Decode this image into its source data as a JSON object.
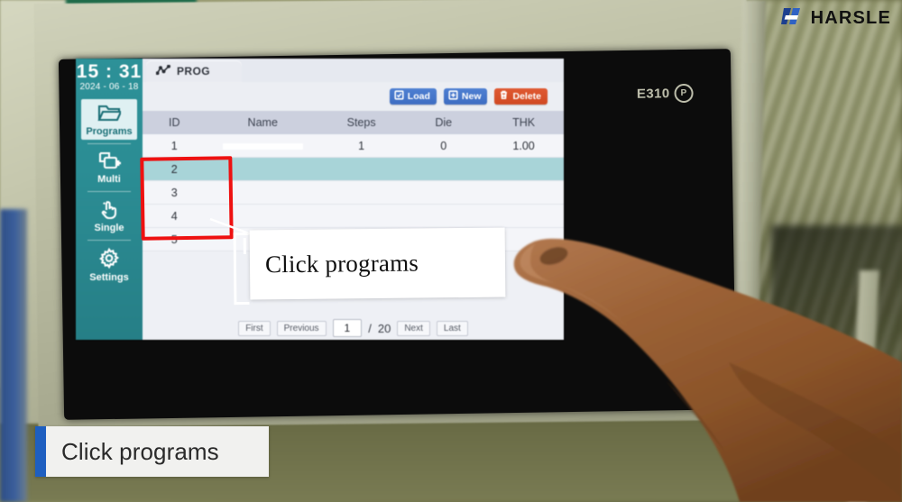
{
  "brand": {
    "name": "HARSLE",
    "logo_icon": "harsle-h-mark",
    "accent": "#1c3f8f"
  },
  "monitor": {
    "model_badge": "E310",
    "model_badge_suffix": "P"
  },
  "hmi": {
    "sidebar": {
      "time": "15 : 31",
      "date": "2024 - 06 - 18",
      "items": [
        {
          "label": "Programs",
          "icon": "folder-open-icon",
          "active": true
        },
        {
          "label": "Multi",
          "icon": "multi-window-plus-icon",
          "active": false
        },
        {
          "label": "Single",
          "icon": "hand-tap-icon",
          "active": false
        },
        {
          "label": "Settings",
          "icon": "gear-icon",
          "active": false
        }
      ],
      "bg_color": "#2d8d93",
      "active_tile_color": "#dff0f2"
    },
    "tab": {
      "label": "PROG",
      "icon": "polyline-graph-icon"
    },
    "toolbar": [
      {
        "label": "Load",
        "icon": "document-check-icon",
        "color": "#4471c6"
      },
      {
        "label": "New",
        "icon": "document-plus-icon",
        "color": "#4471c6"
      },
      {
        "label": "Delete",
        "icon": "trash-icon",
        "color": "#d44f26"
      }
    ],
    "table": {
      "columns": [
        "ID",
        "Name",
        "Steps",
        "Die",
        "THK"
      ],
      "rows": [
        {
          "id": "1",
          "name": "",
          "steps": "1",
          "die": "0",
          "thk": "1.00",
          "selected": false
        },
        {
          "id": "2",
          "name": "",
          "steps": "",
          "die": "",
          "thk": "",
          "selected": true
        },
        {
          "id": "3",
          "name": "",
          "steps": "",
          "die": "",
          "thk": "",
          "selected": false
        },
        {
          "id": "4",
          "name": "",
          "steps": "",
          "die": "",
          "thk": "",
          "selected": false
        },
        {
          "id": "5",
          "name": "",
          "steps": "",
          "die": "",
          "thk": "",
          "selected": false
        }
      ],
      "selected_row_color": "#a9d4d8"
    },
    "pager": {
      "first": "First",
      "previous": "Previous",
      "current_page": "1",
      "separator": "/",
      "total_pages": "20",
      "next": "Next",
      "last": "Last"
    }
  },
  "annotations": {
    "highlight_box_color": "#ee1111",
    "callout_text": "Click programs",
    "subtitle_text": "Click programs",
    "subtitle_accent_color": "#1e5fc0"
  }
}
